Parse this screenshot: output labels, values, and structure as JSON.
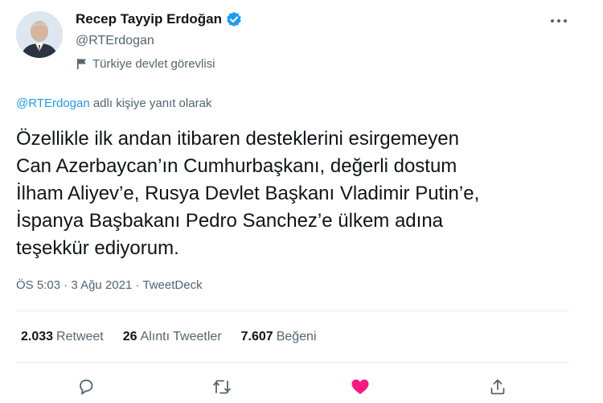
{
  "author": {
    "name": "Recep Tayyip Erdoğan",
    "handle": "@RTErdogan",
    "label": "Türkiye devlet görevlisi",
    "avatar_icon": "profile-photo",
    "verified_icon": "verified-badge-icon"
  },
  "reply": {
    "mention": "@RTErdogan",
    "suffix": " adlı kişiye yanıt olarak"
  },
  "tweet": {
    "text": "Özellikle ilk andan itibaren desteklerini esirgemeyen\nCan Azerbaycan’ın Cumhurbaşkanı, değerli dostum\nİlham Aliyev’e, Rusya Devlet Başkanı Vladimir Putin’e,\nİspanya Başbakanı Pedro Sanchez’e ülkem adına\nteşekkür ediyorum.",
    "time": "ÖS 5:03",
    "date": "3 Ağu 2021",
    "source": "TweetDeck"
  },
  "stats": {
    "retweets": {
      "count": "2.033",
      "label": "Retweet"
    },
    "quotes": {
      "count": "26",
      "label": "Alıntı Tweetler"
    },
    "likes": {
      "count": "7.607",
      "label": "Beğeni"
    }
  },
  "actions": [
    "reply-icon",
    "retweet-icon",
    "like-icon",
    "share-icon"
  ],
  "colors": {
    "accent": "#1d9bf0",
    "like": "#f91880",
    "secondary_text": "#536471",
    "primary_text": "#0f1419"
  }
}
